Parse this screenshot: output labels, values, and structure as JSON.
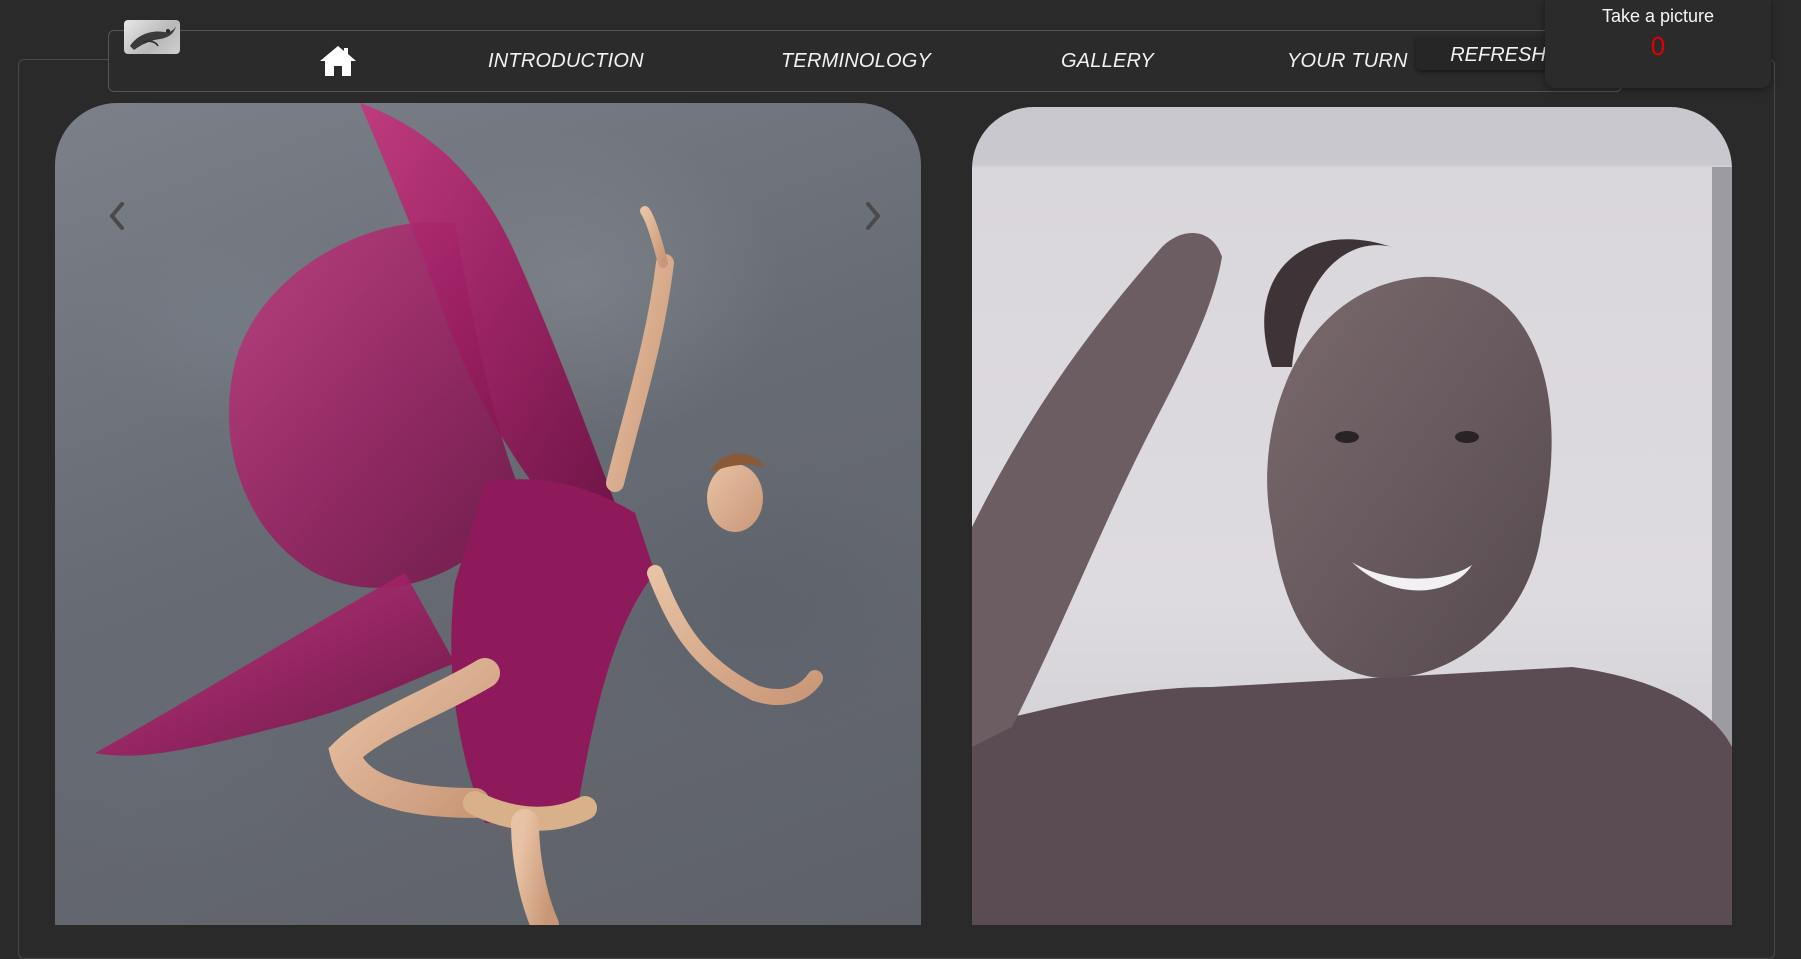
{
  "nav": {
    "links": [
      {
        "label": "INTRODUCTION"
      },
      {
        "label": "TERMINOLOGY"
      },
      {
        "label": "GALLERY"
      },
      {
        "label": "YOUR TURN"
      }
    ],
    "refresh_label": "REFRESH"
  },
  "capture": {
    "label": "Take a picture",
    "count": "0"
  },
  "icons": {
    "home": "home-icon",
    "prev": "chevron-left-icon",
    "next": "chevron-right-icon"
  },
  "colors": {
    "background": "#2a2a2a",
    "counter": "#e00000",
    "dress": "#8e1a5c"
  }
}
